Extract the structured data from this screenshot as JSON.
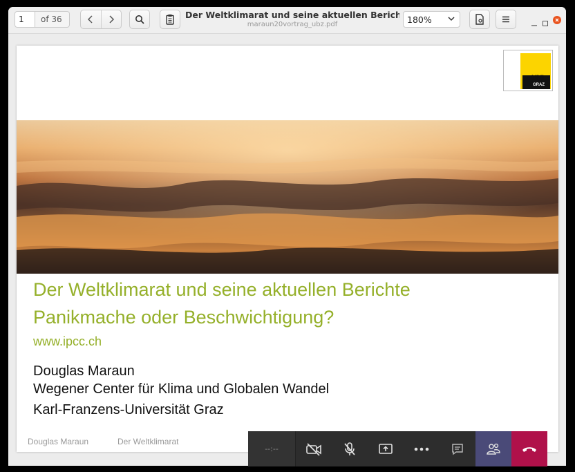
{
  "toolbar": {
    "page_current": "1",
    "page_total": "of 36",
    "doc_title": "Der Weltklimarat und seine aktuellen Berich...",
    "doc_filename": "maraun20vortrag_ubz.pdf",
    "zoom": "180%"
  },
  "slide": {
    "logo": {
      "uni": "UNI",
      "graz": "GRAZ"
    },
    "title_line1": "Der Weltklimarat und seine aktuellen Berichte",
    "title_line2": "Panikmache oder Beschwichtigung?",
    "link": "www.ipcc.ch",
    "author": "Douglas Maraun",
    "affiliation1": "Wegener Center für Klima und Globalen Wandel",
    "affiliation2": "Karl-Franzens-Universität Graz",
    "footer_author": "Douglas Maraun",
    "footer_title": "Der Weltklimarat"
  },
  "callbar": {
    "timer": "--:--",
    "icons": [
      "video-off-icon",
      "mic-off-icon",
      "share-screen-icon",
      "more-icon",
      "chat-icon",
      "participants-icon",
      "hangup-icon"
    ]
  },
  "colors": {
    "title_green": "#95b02a",
    "hangup": "#b0114a",
    "people_bg": "#4a4a78",
    "close": "#e9541f"
  }
}
